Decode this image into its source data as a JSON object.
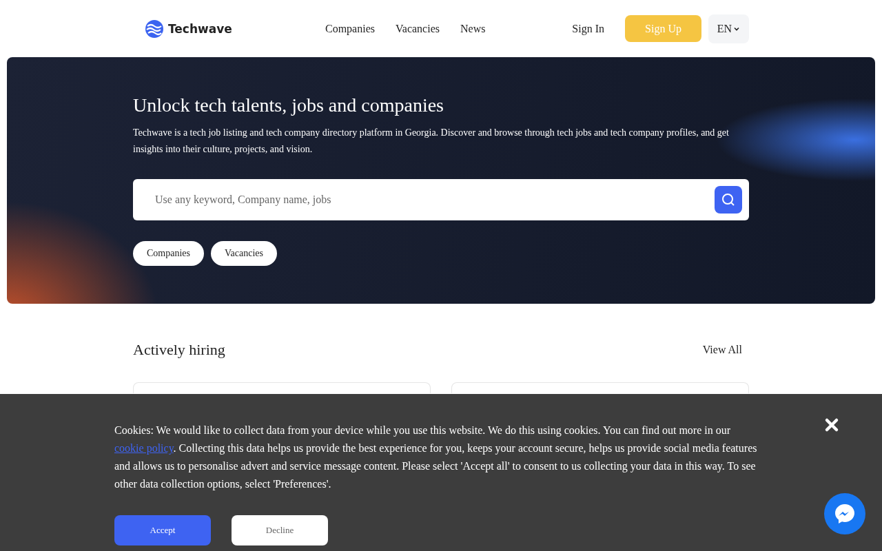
{
  "header": {
    "brand": "Techwave",
    "nav": [
      {
        "label": "Companies"
      },
      {
        "label": "Vacancies"
      },
      {
        "label": "News"
      }
    ],
    "sign_in": "Sign In",
    "sign_up": "Sign Up",
    "language": "EN"
  },
  "hero": {
    "title": "Unlock tech talents, jobs and companies",
    "description": "Techwave is a tech job listing and tech company directory platform in Georgia. Discover and browse through tech jobs and tech company profiles, and get insights into their culture, projects, and vision.",
    "search": {
      "placeholder": "Use any keyword, Company name, jobs"
    },
    "filters": [
      {
        "label": "Companies"
      },
      {
        "label": "Vacancies"
      }
    ]
  },
  "hiring": {
    "title": "Actively hiring",
    "view_all": "View All",
    "companies": [
      {
        "kind": "card"
      },
      {
        "kind": "card"
      }
    ]
  },
  "cookie": {
    "text_before": "Cookies: We would like to collect data from your device while you use this website. We do this using cookies. You can find out more in our ",
    "link": "cookie policy",
    "text_after": ". Collecting this data helps us provide the best experience for you, keeps your account secure, helps us provide social media features and allows us to personalise advert and service message content. Please select 'Accept all' to consent to us collecting your data in this way. To see other data collection options, select 'Preferences'.",
    "accept": "Accept",
    "decline": "Decline"
  }
}
